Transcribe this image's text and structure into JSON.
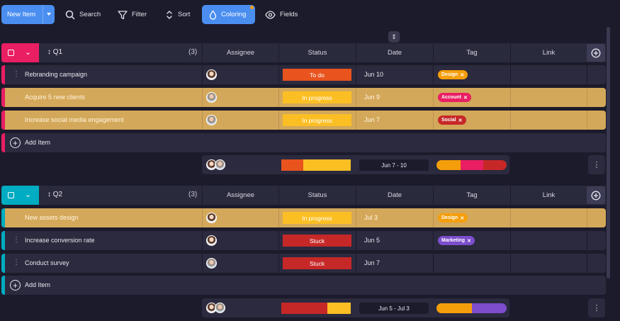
{
  "toolbar": {
    "new_item": "New Item",
    "search": "Search",
    "filter": "Filter",
    "sort": "Sort",
    "coloring": "Coloring",
    "fields": "Fields"
  },
  "columns": [
    "Assignee",
    "Status",
    "Date",
    "Tag",
    "Link"
  ],
  "colors": {
    "q1_accent": "#e91e63",
    "q2_accent": "#00acc1",
    "todo": "#e8531e",
    "in_progress": "#fbbf24",
    "stuck": "#c62828",
    "design_tag": "#f59e0b",
    "account_tag": "#e91e63",
    "social_tag": "#c62828",
    "marketing_tag": "#7c4dcc",
    "highlight_row": "#d4a85a"
  },
  "groups": [
    {
      "name": "Q1",
      "count": "(3)",
      "add_item": "Add Item",
      "summary_date": "Jun 7 - 10",
      "items": [
        {
          "title": "Rebranding campaign",
          "status": "To do",
          "date": "Jun 10",
          "tag": "Design"
        },
        {
          "title": "Acquire 5 new clients",
          "status": "In progress",
          "date": "Jun 9",
          "tag": "Account"
        },
        {
          "title": "Increase social media engagement",
          "status": "In progress",
          "date": "Jun 7",
          "tag": "Social"
        }
      ]
    },
    {
      "name": "Q2",
      "count": "(3)",
      "add_item": "Add Item",
      "summary_date": "Jun 5 - Jul 3",
      "items": [
        {
          "title": "New assets design",
          "status": "In progress",
          "date": "Jul 3",
          "tag": "Design"
        },
        {
          "title": "Increase conversion rate",
          "status": "Stuck",
          "date": "Jun 5",
          "tag": "Marketing"
        },
        {
          "title": "Conduct survey",
          "status": "Stuck",
          "date": "Jun 7",
          "tag": ""
        }
      ]
    }
  ],
  "summary_fills": {
    "q1_status": [
      0.32,
      0.68
    ],
    "q1_tag": [
      0.34,
      0.33,
      0.33
    ],
    "q2_status": [
      0.66,
      0.34
    ],
    "q2_tag": [
      0.5,
      0.5
    ]
  }
}
